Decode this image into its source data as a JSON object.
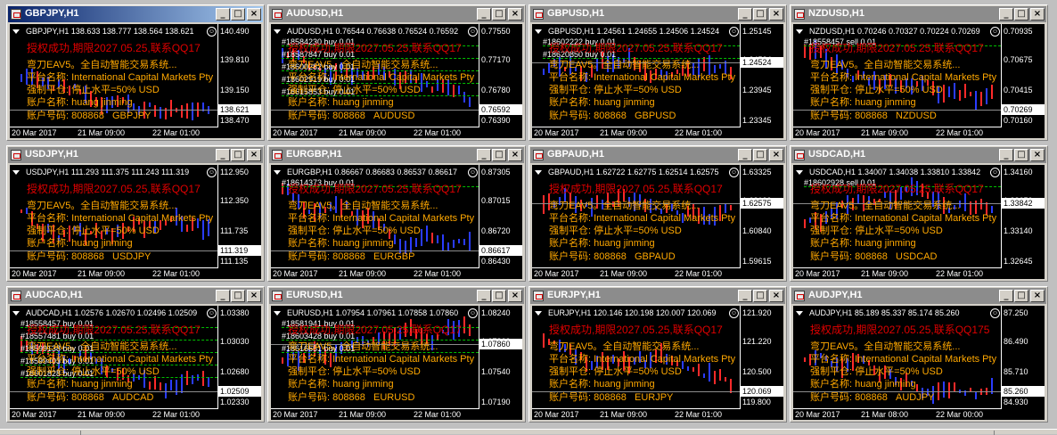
{
  "labels": {
    "name": "平台名称: International Capital Markets Pty",
    "close": "强制平仓: 停止水平=50% USD",
    "holder": "账户名称: huang jinming",
    "account": "账户号码: 808868",
    "ea": "弯刀EAV5。全自动智能交易系统..."
  },
  "windows": [
    {
      "title": "GBPJPY,H1",
      "active": true,
      "header": "GBPJPY,H1  138.633 138.777 138.564 138.621",
      "lic": "授权成功,期限2027.05.25,联系QQ17",
      "sym": "GBPJPY",
      "prices": [
        "140.490",
        "139.810",
        "139.150",
        "138.470"
      ],
      "bid": "138.621",
      "x": [
        "20 Mar 2017",
        "21 Mar 09:00",
        "22 Mar 01:00"
      ],
      "orders": []
    },
    {
      "title": "AUDUSD,H1",
      "header": "AUDUSD,H1  0.76544 0.76638 0.76524 0.76592",
      "lic": "授权成功,期限2027.05.25,联系QQ17",
      "sym": "AUDUSD",
      "prices": [
        "0.77550",
        "0.77170",
        "0.76780",
        "0.76390"
      ],
      "bid": "0.76592",
      "x": [
        "20 Mar 2017",
        "21 Mar 09:00",
        "22 Mar 01:00"
      ],
      "orders": [
        "#18584230 buy 0.01",
        "#18587847 buy 0.01",
        "#18600282 buy 0.01",
        "#18602919 buy 0.01",
        "#18615853 buy 0.01"
      ]
    },
    {
      "title": "GBPUSD,H1",
      "header": "GBPUSD,H1  1.24561 1.24655 1.24506 1.24524",
      "lic": "授权成功,期限2027.05.25,联系QQ17",
      "sym": "GBPUSD",
      "prices": [
        "1.25145",
        "1.24524",
        "1.23945",
        "1.23345"
      ],
      "bid": "1.24524",
      "bidTop": true,
      "x": [
        "20 Mar 2017",
        "21 Mar 09:00",
        "22 Mar 01:00"
      ],
      "orders": [
        "#18602222 buy 0.01",
        "#18620850 buy 0.01"
      ]
    },
    {
      "title": "NZDUSD,H1",
      "header": "NZDUSD,H1  0.70246 0.70327 0.70224 0.70269",
      "lic": "授权成功,期限2027.05.25,联系QQ17",
      "sym": "NZDUSD",
      "prices": [
        "0.70935",
        "0.70675",
        "0.70415",
        "0.70160"
      ],
      "bid": "0.70269",
      "x": [
        "20 Mar 2017",
        "21 Mar 09:00",
        "22 Mar 01:00"
      ],
      "orders": [
        "#18558457 sell 0.01"
      ]
    },
    {
      "title": "USDJPY,H1",
      "header": "USDJPY,H1  111.293 111.375 111.243 111.319",
      "lic": "授权成功,期限2027.05.25,联系QQ17",
      "sym": "USDJPY",
      "prices": [
        "112.950",
        "112.350",
        "111.735",
        "111.135"
      ],
      "bid": "111.319",
      "x": [
        "20 Mar 2017",
        "21 Mar 09:00",
        "22 Mar 01:00"
      ],
      "orders": []
    },
    {
      "title": "EURGBP,H1",
      "header": "EURGBP,H1  0.86667 0.86683 0.86537 0.86617",
      "lic": "授权成功,期限2027.05.25,联系QQ17",
      "sym": "EURGBP",
      "prices": [
        "0.87305",
        "0.87015",
        "0.86720",
        "0.86430"
      ],
      "bid": "0.86617",
      "x": [
        "20 Mar 2017",
        "21 Mar 09:00",
        "22 Mar 01:00"
      ],
      "orders": [
        "#18614373 buy 0.01"
      ]
    },
    {
      "title": "GBPAUD,H1",
      "header": "GBPAUD,H1  1.62722 1.62775 1.62514 1.62575",
      "lic": "授权成功,期限2027.05.25,联系QQ17",
      "sym": "GBPAUD",
      "prices": [
        "1.63325",
        "1.62100",
        "1.60840",
        "1.59615"
      ],
      "bid": "1.62575",
      "bidTop": true,
      "x": [
        "20 Mar 2017",
        "21 Mar 09:00",
        "22 Mar 01:00"
      ],
      "orders": []
    },
    {
      "title": "USDCAD,H1",
      "header": "USDCAD,H1  1.34007 1.34038 1.33810 1.33842",
      "lic": "授权成功,期限2027.05.25,联系QQ17",
      "sym": "USDCAD",
      "prices": [
        "1.34160",
        "1.33650",
        "1.33140",
        "1.32645"
      ],
      "bid": "1.33842",
      "bidTop": true,
      "x": [
        "20 Mar 2017",
        "21 Mar 09:00",
        "22 Mar 01:00"
      ],
      "orders": [
        "#18602928 sell 0.01"
      ]
    },
    {
      "title": "AUDCAD,H1",
      "header": "AUDCAD,H1  1.02576 1.02670 1.02496 1.02509",
      "lic": "授权成功,期限2027.05.25,联系QQ17",
      "sym": "AUDCAD",
      "prices": [
        "1.03380",
        "1.03030",
        "1.02680",
        "1.02330"
      ],
      "bid": "1.02509",
      "x": [
        "20 Mar 2017",
        "21 Mar 09:00",
        "22 Mar 01:00"
      ],
      "orders": [
        "#18558457 buy 0.01",
        "#18557481 buy 0.01",
        "#18599138 buy 0.01",
        "#18599403 buy 0.01",
        "#18601828 buy 0.01"
      ]
    },
    {
      "title": "EURUSD,H1",
      "header": "EURUSD,H1  1.07954 1.07961 1.07858 1.07860",
      "lic": "授权成功,期限2027.05.25,联系QQ17",
      "sym": "EURUSD",
      "prices": [
        "1.08240",
        "1.07860",
        "1.07540",
        "1.07190"
      ],
      "bid": "1.07860",
      "bidTop": true,
      "x": [
        "20 Mar 2017",
        "21 Mar 09:00",
        "22 Mar 01:00"
      ],
      "orders": [
        "#18581941 buy 0.01",
        "#18603428 buy 0.01",
        "#18616651 buy 0.01"
      ]
    },
    {
      "title": "EURJPY,H1",
      "header": "EURJPY,H1  120.146 120.198 120.007 120.069",
      "lic": "授权成功,期限2027.05.25,联系QQ17",
      "sym": "EURJPY",
      "prices": [
        "121.920",
        "121.220",
        "120.500",
        "119.800"
      ],
      "bid": "120.069",
      "x": [
        "20 Mar 2017",
        "21 Mar 09:00",
        "22 Mar 01:00"
      ],
      "orders": []
    },
    {
      "title": "AUDJPY,H1",
      "header": "AUDJPY,H1  85.189 85.337 85.174 85.260",
      "lic": "授权成功,期限2027.05.25,联系QQ175",
      "sym": "AUDJPY",
      "prices": [
        "87.250",
        "86.490",
        "85.710",
        "84.930"
      ],
      "bid": "85.260",
      "x": [
        "20 Mar 2017",
        "21 Mar 08:00",
        "22 Mar 00:00"
      ],
      "orders": []
    }
  ]
}
